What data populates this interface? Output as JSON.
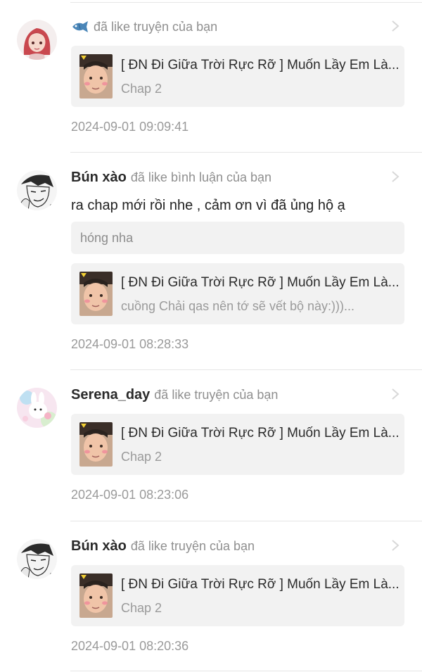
{
  "notifications": [
    {
      "username": "",
      "action": "đã like truyện của bạn",
      "story_title": "[ ĐN Đi Giữa Trời Rực Rỡ ] Muốn Lầy Em Là...",
      "story_sub": "Chap 2",
      "time": "2024-09-01 09:09:41",
      "avatar": "avatar-red-hair-girl",
      "badge_icon": "fish-icon"
    },
    {
      "username": "Bún xào",
      "action": "đã like bình luận của bạn",
      "comment": "ra chap mới rồi nhe , cảm ơn vì đã ủng hộ ạ",
      "quoted_comment": "hóng nha",
      "story_title": "[ ĐN Đi Giữa Trời Rực Rỡ ] Muốn Lầy Em Là...",
      "story_sub": "cuồng Chải qas nên tớ sẽ vết bộ này:)))...",
      "time": "2024-09-01 08:28:33",
      "avatar": "avatar-manga-boy"
    },
    {
      "username": "Serena_day",
      "action": "đã like truyện của bạn",
      "story_title": "[ ĐN Đi Giữa Trời Rực Rỡ ] Muốn Lầy Em Là...",
      "story_sub": "Chap 2",
      "time": "2024-09-01 08:23:06",
      "avatar": "avatar-pastel-bunny"
    },
    {
      "username": "Bún xào",
      "action": "đã like truyện của bạn",
      "story_title": "[ ĐN Đi Giữa Trời Rực Rỡ ] Muốn Lầy Em Là...",
      "story_sub": "Chap 2",
      "time": "2024-09-01 08:20:36",
      "avatar": "avatar-manga-boy"
    }
  ],
  "colors": {
    "card_bg": "#f2f2f2",
    "meta_text": "#9a9a9a",
    "divider": "#e6e6e6"
  }
}
